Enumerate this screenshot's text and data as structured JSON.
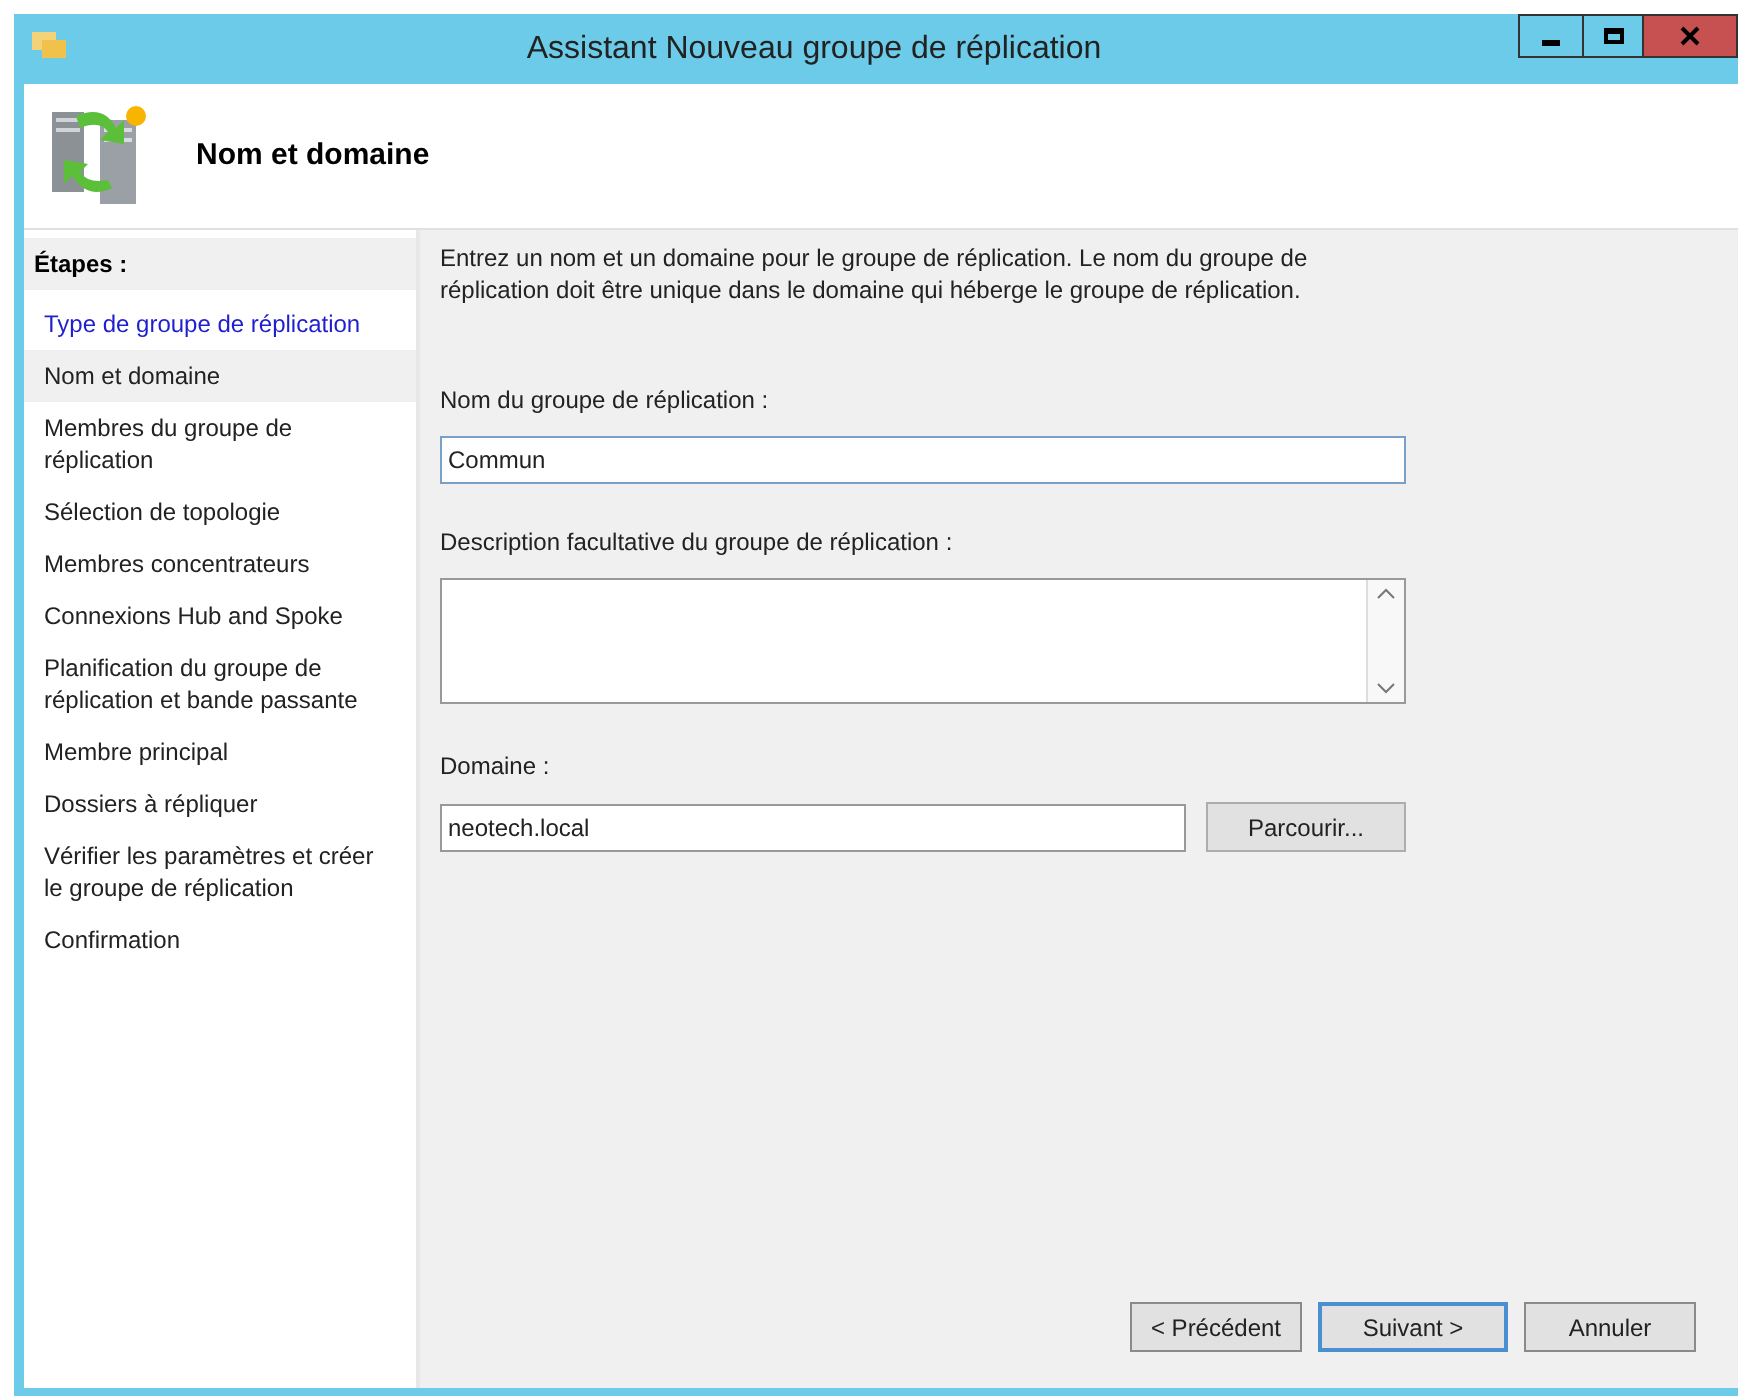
{
  "window": {
    "title": "Assistant Nouveau groupe de réplication"
  },
  "header": {
    "title": "Nom et domaine"
  },
  "steps": {
    "heading": "Étapes :",
    "items": [
      {
        "label": "Type de groupe de réplication",
        "completed": true,
        "selected": false
      },
      {
        "label": "Nom et domaine",
        "completed": false,
        "selected": true
      },
      {
        "label": "Membres du groupe de réplication",
        "completed": false,
        "selected": false
      },
      {
        "label": "Sélection de topologie",
        "completed": false,
        "selected": false
      },
      {
        "label": "Membres concentrateurs",
        "completed": false,
        "selected": false
      },
      {
        "label": "Connexions Hub and Spoke",
        "completed": false,
        "selected": false
      },
      {
        "label": "Planification du groupe de réplication et bande passante",
        "completed": false,
        "selected": false
      },
      {
        "label": "Membre principal",
        "completed": false,
        "selected": false
      },
      {
        "label": "Dossiers à répliquer",
        "completed": false,
        "selected": false
      },
      {
        "label": "Vérifier les paramètres et créer le groupe de réplication",
        "completed": false,
        "selected": false
      },
      {
        "label": "Confirmation",
        "completed": false,
        "selected": false
      }
    ]
  },
  "intro": "Entrez un nom et un domaine pour le groupe de réplication. Le nom du groupe de réplication doit être unique dans le domaine qui héberge le groupe de réplication.",
  "name_field": {
    "label": "Nom du groupe de réplication :",
    "value": "Commun"
  },
  "description_field": {
    "label": "Description facultative du groupe de réplication :"
  },
  "domain_field": {
    "label": "Domaine :",
    "value": "neotech.local",
    "browse": "Parcourir..."
  },
  "buttons": [
    {
      "label": "< Précédent",
      "default": false
    },
    {
      "label": "Suivant >",
      "default": true
    },
    {
      "label": "Annuler",
      "default": false
    }
  ]
}
